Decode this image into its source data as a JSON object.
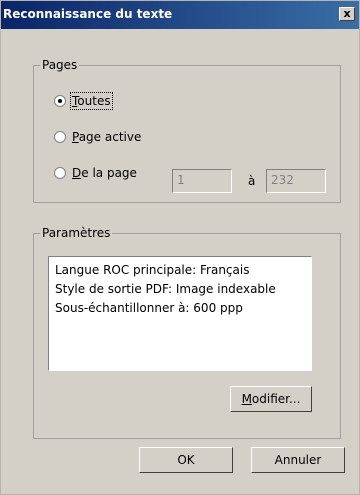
{
  "dialog": {
    "title": "Reconnaissance du texte",
    "close_glyph": "x"
  },
  "pages_group": {
    "label": "Pages",
    "options": [
      {
        "mnemonic": "T",
        "rest": "outes",
        "selected": true
      },
      {
        "mnemonic": "P",
        "rest": "age active",
        "selected": false
      },
      {
        "mnemonic": "D",
        "rest": "e la page",
        "selected": false
      }
    ],
    "from_value": "1",
    "to_label": "à",
    "to_value": "232"
  },
  "params_group": {
    "label": "Paramètres",
    "lines": [
      "Langue ROC principale: Français",
      "Style de sortie PDF: Image indexable",
      "Sous-échantillonner à: 600 ppp"
    ],
    "modify_mnemonic": "M",
    "modify_rest": "odifier..."
  },
  "buttons": {
    "ok": "OK",
    "cancel": "Annuler"
  }
}
